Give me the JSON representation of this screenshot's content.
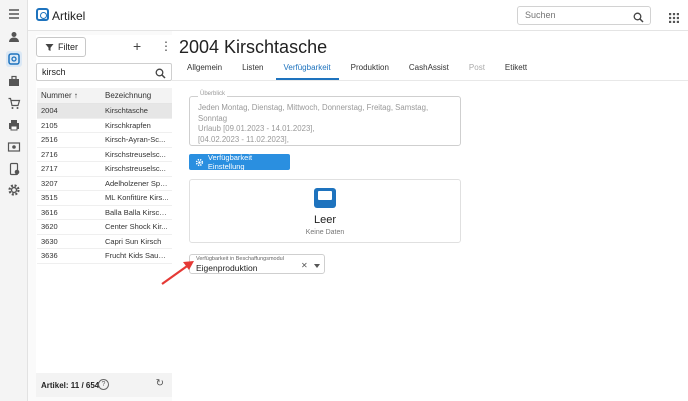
{
  "app": {
    "title": "Artikel",
    "icon": "article-icon"
  },
  "search": {
    "placeholder": "Suchen"
  },
  "rail_icons": [
    "menu-icon",
    "user-icon",
    "article-icon",
    "toolbox-icon",
    "cart-icon",
    "printer-icon",
    "dollar-icon",
    "phone-icon",
    "gear-icon"
  ],
  "list": {
    "filter_label": "Filter",
    "search_value": "kirsch",
    "columns": [
      "Nummer",
      "Bezeichnung"
    ],
    "rows": [
      {
        "nr": "2004",
        "name": "Kirschtasche",
        "selected": true
      },
      {
        "nr": "2105",
        "name": "Kirschkrapfen"
      },
      {
        "nr": "2516",
        "name": "Kirsch-Ayran-Sc..."
      },
      {
        "nr": "2716",
        "name": "Kirschstreuselsc..."
      },
      {
        "nr": "2717",
        "name": "Kirschstreuselsc..."
      },
      {
        "nr": "3207",
        "name": "Adelholzener Spo..."
      },
      {
        "nr": "3515",
        "name": "ML Konfitüre Kirs..."
      },
      {
        "nr": "3616",
        "name": "Balla Balla Kirsch ..."
      },
      {
        "nr": "3620",
        "name": "Center Shock Kir..."
      },
      {
        "nr": "3630",
        "name": "Capri Sun Kirsch"
      },
      {
        "nr": "3636",
        "name": "Frucht Kids Sauer..."
      }
    ],
    "footer": "Artikel: 11 / 654"
  },
  "detail": {
    "title": "2004 Kirschtasche",
    "tabs": [
      {
        "label": "Allgemein"
      },
      {
        "label": "Listen"
      },
      {
        "label": "Verfügbarkeit",
        "active": true
      },
      {
        "label": "Produktion"
      },
      {
        "label": "CashAssist"
      },
      {
        "label": "Post",
        "disabled": true
      },
      {
        "label": "Etikett"
      }
    ],
    "ueberblick_label": "Überblick",
    "ueberblick_text": "Jeden Montag, Dienstag, Mittwoch, Donnerstag, Freitag, Samstag, Sonntag\nUrlaub [09.01.2023 - 14.01.2023],\n[04.02.2023 - 11.02.2023],",
    "button_label": "Verfügbarkeit Einstellung",
    "empty_title": "Leer",
    "empty_sub": "Keine Daten",
    "select_label": "Verfügbarkeit in Beschaffungsmodul",
    "select_value": "Eigenproduktion"
  },
  "colors": {
    "accent": "#1e73be",
    "button": "#2a8fe0",
    "arrow": "#e53935"
  }
}
